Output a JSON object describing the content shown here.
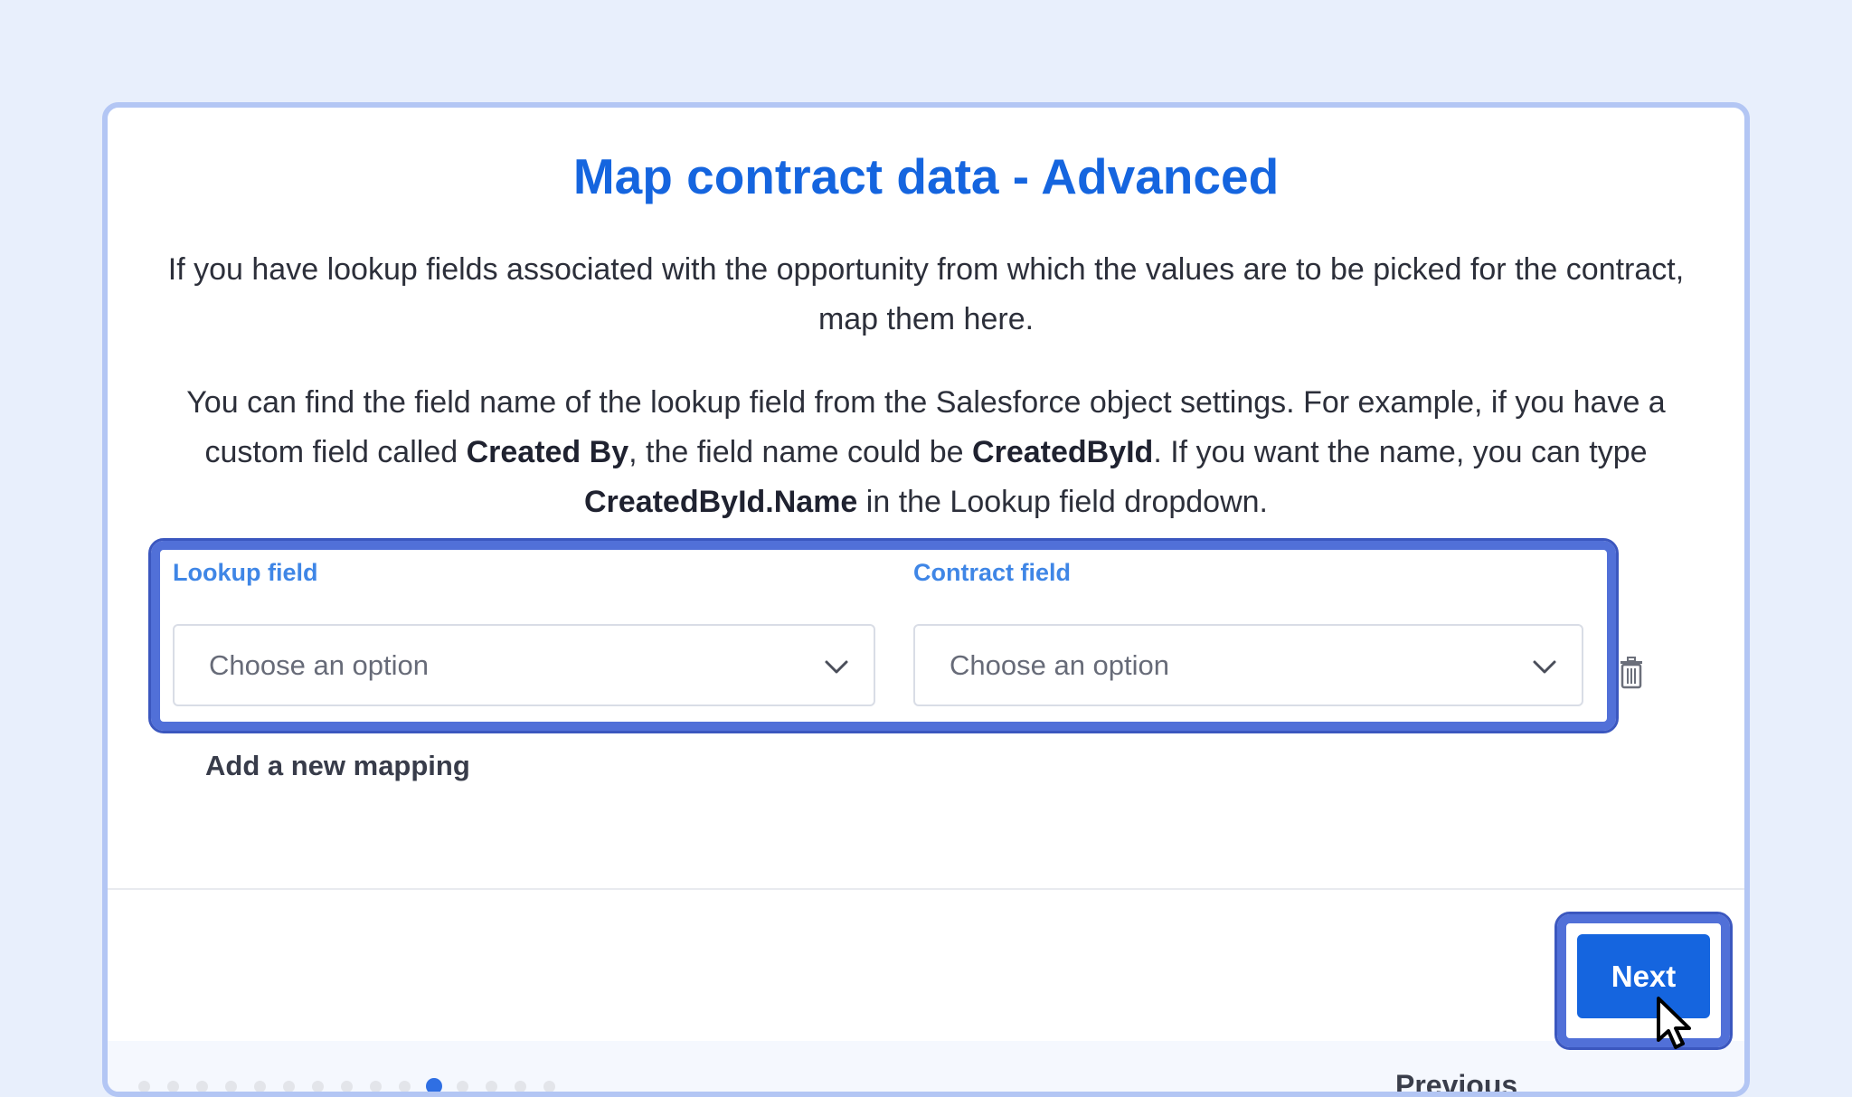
{
  "dialog": {
    "title": "Map contract data - Advanced",
    "intro": "If you have lookup fields associated with the opportunity from which the values are to be picked for the contract, map them here.",
    "help": {
      "t1": "You can find the field name of the lookup field from the Salesforce object settings. For example, if you have a custom field called ",
      "b1": "Created By",
      "t2": ", the field name could be ",
      "b2": "CreatedById",
      "t3": ". If you want the name, you can type ",
      "b3": "CreatedById.Name",
      "t4": " in the Lookup field dropdown."
    }
  },
  "mapping": {
    "lookup_label": "Lookup field",
    "contract_label": "Contract field",
    "lookup_placeholder": "Choose an option",
    "contract_placeholder": "Choose an option",
    "add_label": "Add a new mapping"
  },
  "footer": {
    "previous_label": "Previous",
    "next_label": "Next",
    "step_total": 15,
    "step_current": 11
  },
  "colors": {
    "accent": "#1565df",
    "highlight": "#5170d8"
  },
  "icons": {
    "chevron": "chevron-down-icon",
    "delete": "trash-icon",
    "cursor": "mouse-pointer-icon"
  }
}
